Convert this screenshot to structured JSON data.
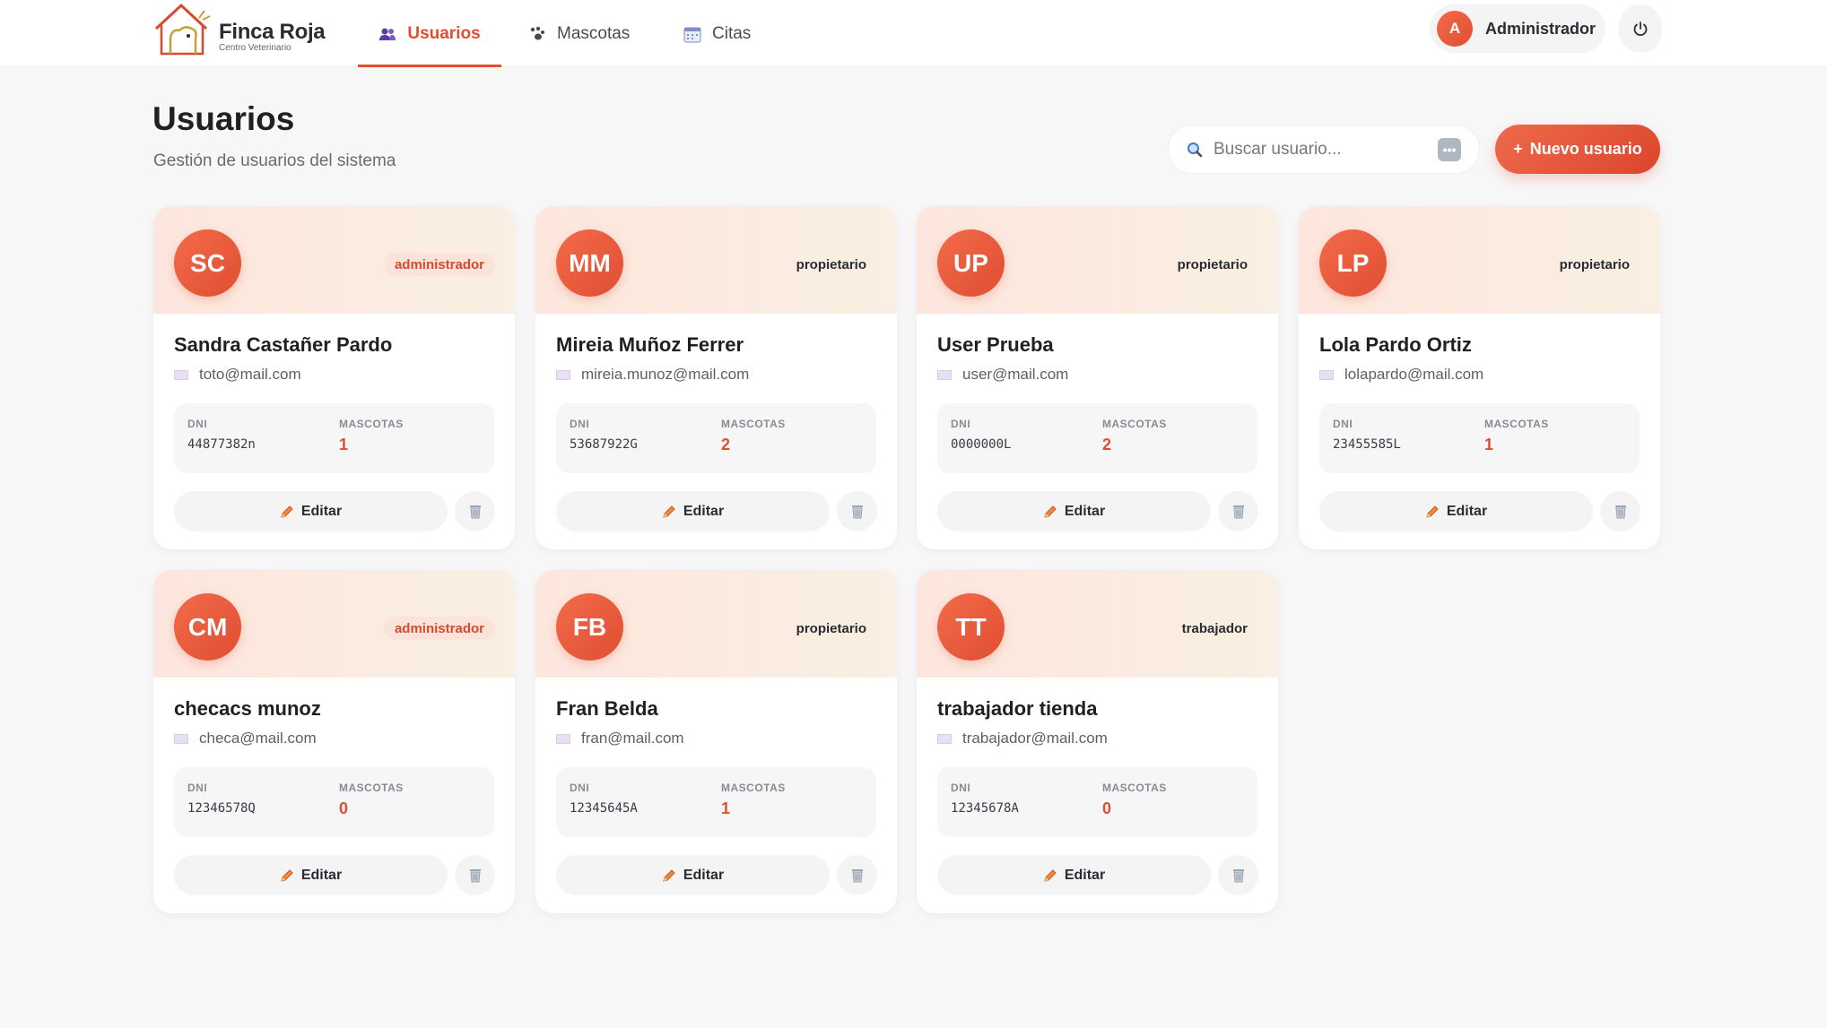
{
  "app": {
    "name": "Finca Roja",
    "tagline": "Centro Veterinario"
  },
  "nav": {
    "tabs": [
      {
        "label": "Usuarios",
        "icon": "users-icon",
        "active": true
      },
      {
        "label": "Mascotas",
        "icon": "paw-icon",
        "active": false
      },
      {
        "label": "Citas",
        "icon": "calendar-icon",
        "active": false
      }
    ],
    "user": {
      "initial": "A",
      "name": "Administrador"
    },
    "logout_icon": "power-icon"
  },
  "header": {
    "title": "Usuarios",
    "subtitle": "Gestión de usuarios del sistema"
  },
  "search": {
    "placeholder": "Buscar usuario...",
    "icon": "search-icon"
  },
  "new_button": {
    "plus": "+",
    "label": "Nuevo usuario"
  },
  "labels": {
    "dni": "DNI",
    "pets": "MASCOTAS",
    "edit": "Editar"
  },
  "colors": {
    "accent": "#e04e32",
    "admin_badge_bg": "#fbe3da"
  },
  "users": [
    {
      "initials": "SC",
      "role": "administrador",
      "name": "Sandra Castañer Pardo",
      "email": "toto@mail.com",
      "dni": "44877382n",
      "pets": "1"
    },
    {
      "initials": "MM",
      "role": "propietario",
      "name": "Mireia Muñoz Ferrer",
      "email": "mireia.munoz@mail.com",
      "dni": "53687922G",
      "pets": "2"
    },
    {
      "initials": "UP",
      "role": "propietario",
      "name": "User Prueba",
      "email": "user@mail.com",
      "dni": "0000000L",
      "pets": "2"
    },
    {
      "initials": "LP",
      "role": "propietario",
      "name": "Lola Pardo Ortiz",
      "email": "lolapardo@mail.com",
      "dni": "23455585L",
      "pets": "1"
    },
    {
      "initials": "CM",
      "role": "administrador",
      "name": "checacs munoz",
      "email": "checa@mail.com",
      "dni": "12346578Q",
      "pets": "0"
    },
    {
      "initials": "FB",
      "role": "propietario",
      "name": "Fran Belda",
      "email": "fran@mail.com",
      "dni": "12345645A",
      "pets": "1"
    },
    {
      "initials": "TT",
      "role": "trabajador",
      "name": "trabajador tienda",
      "email": "trabajador@mail.com",
      "dni": "12345678A",
      "pets": "0"
    }
  ]
}
